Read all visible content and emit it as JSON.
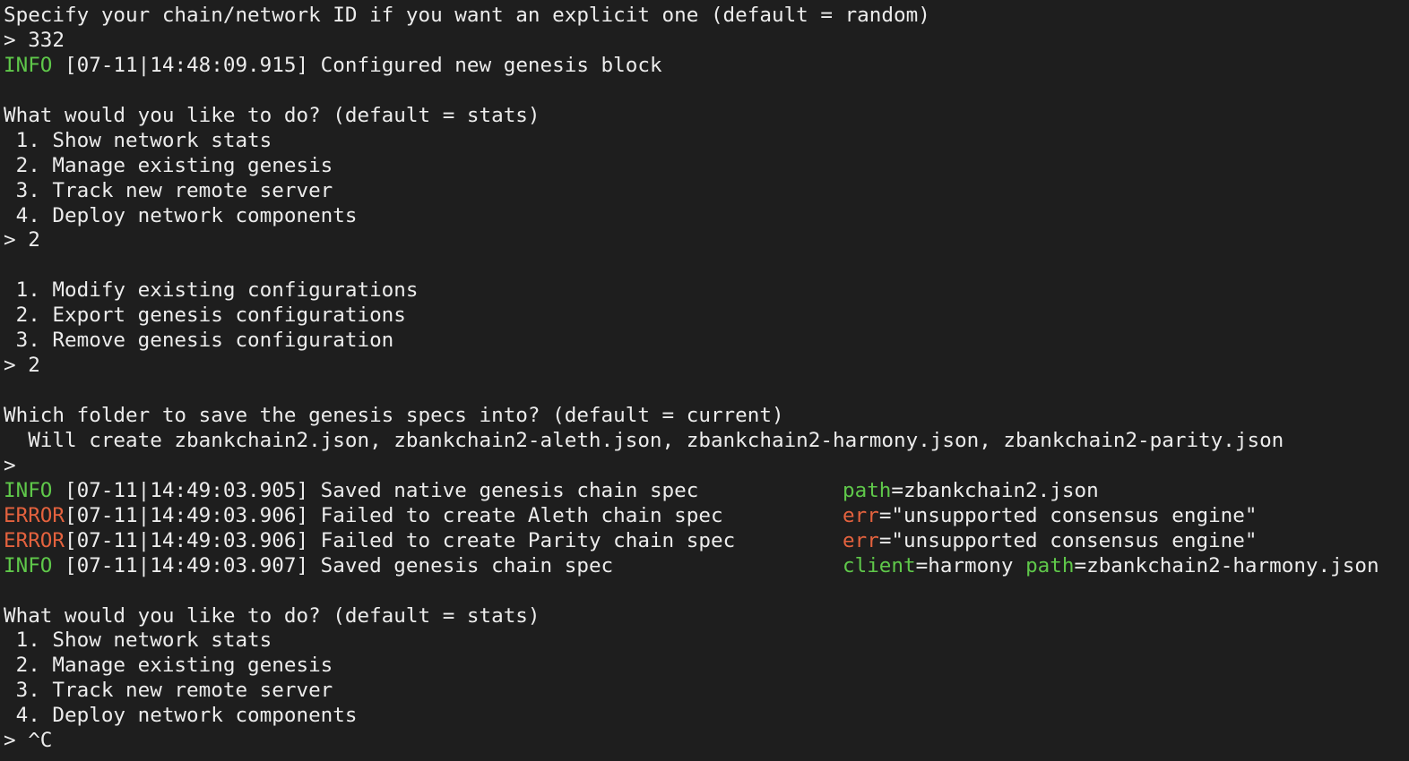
{
  "colors": {
    "background": "#1e1e1e",
    "text": "#ececec",
    "info": "#5fc84a",
    "error": "#e4623e"
  },
  "lines": [
    {
      "type": "text",
      "text": "Specify your chain/network ID if you want an explicit one (default = random)"
    },
    {
      "type": "prompt",
      "text": "> 332"
    },
    {
      "type": "log",
      "level": "INFO ",
      "levelClass": "info",
      "time": "[07-11|14:48:09.915]",
      "msg": " Configured new genesis block",
      "meta": []
    },
    {
      "type": "blank",
      "text": ""
    },
    {
      "type": "text",
      "text": "What would you like to do? (default = stats)"
    },
    {
      "type": "menu",
      "text": " 1. Show network stats"
    },
    {
      "type": "menu",
      "text": " 2. Manage existing genesis"
    },
    {
      "type": "menu",
      "text": " 3. Track new remote server"
    },
    {
      "type": "menu",
      "text": " 4. Deploy network components"
    },
    {
      "type": "prompt",
      "text": "> 2"
    },
    {
      "type": "blank",
      "text": ""
    },
    {
      "type": "menu",
      "text": " 1. Modify existing configurations"
    },
    {
      "type": "menu",
      "text": " 2. Export genesis configurations"
    },
    {
      "type": "menu",
      "text": " 3. Remove genesis configuration"
    },
    {
      "type": "prompt",
      "text": "> 2"
    },
    {
      "type": "blank",
      "text": ""
    },
    {
      "type": "text",
      "text": "Which folder to save the genesis specs into? (default = current)"
    },
    {
      "type": "text",
      "text": "  Will create zbankchain2.json, zbankchain2-aleth.json, zbankchain2-harmony.json, zbankchain2-parity.json"
    },
    {
      "type": "prompt",
      "text": ">"
    },
    {
      "type": "log",
      "level": "INFO ",
      "levelClass": "info",
      "time": "[07-11|14:49:03.905]",
      "msg": " Saved native genesis chain spec",
      "meta": [
        {
          "key": "path",
          "keyClass": "key-green",
          "val": "=zbankchain2.json"
        }
      ]
    },
    {
      "type": "log",
      "level": "ERROR",
      "levelClass": "error",
      "time": "[07-11|14:49:03.906]",
      "msg": " Failed to create Aleth chain spec",
      "meta": [
        {
          "key": "err",
          "keyClass": "key-red",
          "val": "=\"unsupported consensus engine\""
        }
      ]
    },
    {
      "type": "log",
      "level": "ERROR",
      "levelClass": "error",
      "time": "[07-11|14:49:03.906]",
      "msg": " Failed to create Parity chain spec",
      "meta": [
        {
          "key": "err",
          "keyClass": "key-red",
          "val": "=\"unsupported consensus engine\""
        }
      ]
    },
    {
      "type": "log",
      "level": "INFO ",
      "levelClass": "info",
      "time": "[07-11|14:49:03.907]",
      "msg": " Saved genesis chain spec",
      "meta": [
        {
          "key": "client",
          "keyClass": "key-green",
          "val": "=harmony "
        },
        {
          "key": "path",
          "keyClass": "key-green",
          "val": "=zbankchain2-harmony.json"
        }
      ]
    },
    {
      "type": "blank",
      "text": ""
    },
    {
      "type": "text",
      "text": "What would you like to do? (default = stats)"
    },
    {
      "type": "menu",
      "text": " 1. Show network stats"
    },
    {
      "type": "menu",
      "text": " 2. Manage existing genesis"
    },
    {
      "type": "menu",
      "text": " 3. Track new remote server"
    },
    {
      "type": "menu",
      "text": " 4. Deploy network components"
    },
    {
      "type": "prompt",
      "text": "> ^C"
    }
  ]
}
